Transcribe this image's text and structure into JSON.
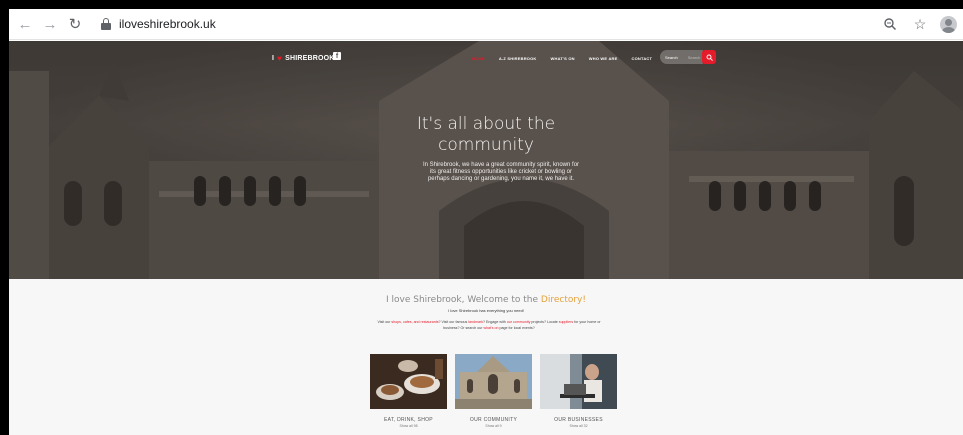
{
  "browser": {
    "url": "iloveshirebrook.uk",
    "back_icon": "arrow-left-icon",
    "forward_icon": "arrow-right-icon",
    "reload_icon": "reload-icon",
    "zoom_icon": "zoom-icon",
    "bookmark_icon": "star-icon",
    "profile_icon": "avatar-icon"
  },
  "site": {
    "logo_prefix": "I",
    "logo_text": "SHIREBROOK",
    "facebook_icon": "facebook-icon",
    "menu": [
      "HOME",
      "A-Z SHIREBROOK",
      "WHAT'S ON",
      "WHO WE ARE",
      "CONTACT"
    ],
    "active_menu_index": 0,
    "search_label": "Search",
    "search_placeholder": "Search",
    "search_icon": "search-icon",
    "accent_color": "#e41b2a"
  },
  "hero": {
    "title_line1": "It's all about the",
    "title_line2": "community",
    "text": "In Shirebrook, we have a great community spirit, known for its great fitness opportunities like cricket or bowling or perhaps dancing or gardening, you name it, we have it."
  },
  "directory": {
    "heading_part1": "I love Shirebrook, Welcome to the ",
    "heading_accent": "Directory!",
    "subline": "I love Shirebrook has everything you need!",
    "para_1": "Visit our ",
    "para_link1": "shops, cafes, and restaurants",
    "para_2": "? Visit our famous ",
    "para_link2": "landmark",
    "para_3": "? Engage with ",
    "para_link3": "our community",
    "para_4": " projects? Locate ",
    "para_link4": "suppliers",
    "para_5": " for your home or business? Or search our ",
    "para_link5": "what's on",
    "para_6": " page for local events?",
    "cards": [
      {
        "title": "EAT, DRINK, SHOP",
        "sub": "Show all 98"
      },
      {
        "title": "OUR COMMUNITY",
        "sub": "Show all 9"
      },
      {
        "title": "OUR BUSINESSES",
        "sub": "Show all 32"
      }
    ]
  }
}
